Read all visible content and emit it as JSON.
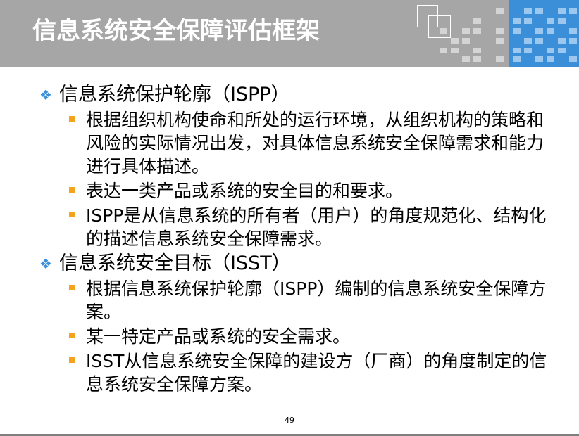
{
  "slide": {
    "title": "信息系统安全保障评估框架",
    "page_number": "49"
  },
  "sections": [
    {
      "heading": "信息系统保护轮廓（ISPP）",
      "items": [
        "根据组织机构使命和所处的运行环境，从组织机构的策略和风险的实际情况出发，对具体信息系统安全保障需求和能力进行具体描述。",
        "表达一类产品或系统的安全目的和要求。",
        "ISPP是从信息系统的所有者（用户）的角度规范化、结构化的描述信息系统安全保障需求。"
      ]
    },
    {
      "heading": "信息系统安全目标（ISST）",
      "items": [
        "根据信息系统保护轮廓（ISPP）编制的信息系统安全保障方案。",
        "某一特定产品或系统的安全需求。",
        "ISST从信息系统安全保障的建设方（厂商）的角度制定的信息系统安全保障方案。"
      ]
    }
  ],
  "colors": {
    "title_bar": "#a6a6a6",
    "accent_blue": "#3a8fd8",
    "bullet_orange": "#f5a31a"
  },
  "icons": {
    "level1_marker": "diamond-bullet-icon",
    "level2_marker": "square-bullet-icon"
  }
}
